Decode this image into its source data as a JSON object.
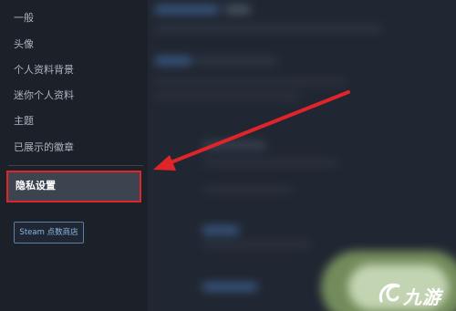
{
  "sidebar": {
    "items": [
      {
        "label": "一般"
      },
      {
        "label": "头像"
      },
      {
        "label": "个人资料背景"
      },
      {
        "label": "迷你个人资料"
      },
      {
        "label": "主题"
      },
      {
        "label": "已展示的徽章"
      }
    ],
    "active_item": {
      "label": "隐私设置"
    },
    "store_button": {
      "label": "Steam 点数商店"
    }
  },
  "annotation": {
    "arrow_color": "#e0252a",
    "highlight_color": "#e0252a"
  },
  "watermark": {
    "text": "九游"
  },
  "colors": {
    "background": "#1d222b",
    "sidebar": "#1b2029",
    "active_bg": "#3d4450",
    "button_border": "#5c7fa6",
    "button_text": "#8fb8e0"
  }
}
